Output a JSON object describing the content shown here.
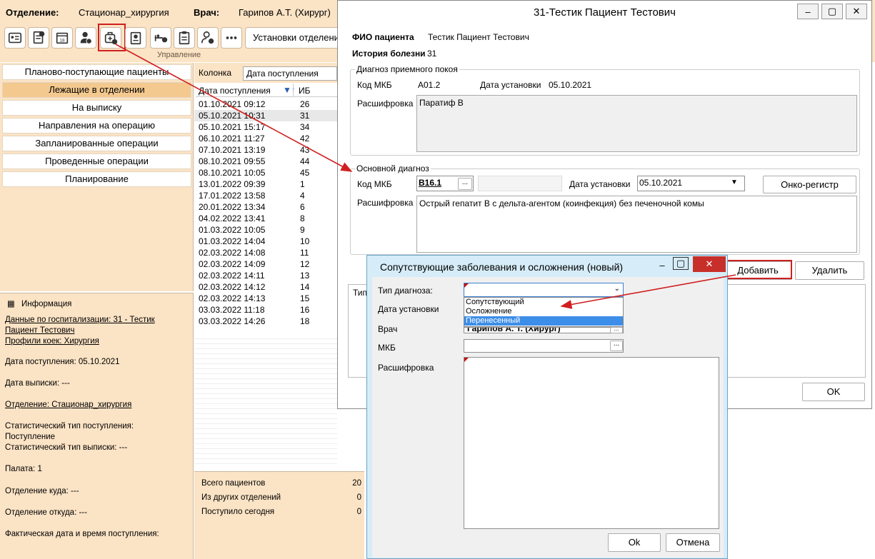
{
  "header": {
    "dept_label": "Отделение:",
    "dept_value": "Стационар_хирургия",
    "doctor_label": "Врач:",
    "doctor_value": "Гарипов А.Т. (Хирург)"
  },
  "toolbar": {
    "group_label": "Управление",
    "settings_label": "Установки отделения",
    "icons": [
      "patient-card-icon",
      "document-add-icon",
      "calendar-icon",
      "doctor-icon",
      "medical-bag-icon",
      "badge-icon",
      "stretcher-icon",
      "clipboard-icon",
      "user-arrow-icon",
      "more-icon"
    ]
  },
  "nav": {
    "items": [
      "Планово-поступающие пациенты",
      "Лежащие в отделении",
      "На выписку",
      "Направления на операцию",
      "Запланированные операции",
      "Проведенные операции",
      "Планирование"
    ],
    "selected": 1
  },
  "list": {
    "column_label": "Колонка",
    "column_value": "Дата поступления",
    "headers": [
      "Дата поступления",
      "ИБ"
    ],
    "rows": [
      [
        "01.10.2021 09:12",
        "26"
      ],
      [
        "05.10.2021 10:31",
        "31"
      ],
      [
        "05.10.2021 15:17",
        "34"
      ],
      [
        "06.10.2021 11:27",
        "42"
      ],
      [
        "07.10.2021 13:19",
        "43"
      ],
      [
        "08.10.2021 09:55",
        "44"
      ],
      [
        "08.10.2021 10:05",
        "45"
      ],
      [
        "13.01.2022 09:39",
        "1"
      ],
      [
        "17.01.2022 13:58",
        "4"
      ],
      [
        "20.01.2022 13:34",
        "6"
      ],
      [
        "04.02.2022 13:41",
        "8"
      ],
      [
        "01.03.2022 10:05",
        "9"
      ],
      [
        "01.03.2022 14:04",
        "10"
      ],
      [
        "02.03.2022 14:08",
        "11"
      ],
      [
        "02.03.2022 14:09",
        "12"
      ],
      [
        "02.03.2022 14:11",
        "13"
      ],
      [
        "02.03.2022 14:12",
        "14"
      ],
      [
        "02.03.2022 14:13",
        "15"
      ],
      [
        "03.03.2022 11:18",
        "16"
      ],
      [
        "03.03.2022 14:26",
        "18"
      ]
    ]
  },
  "info": {
    "title": "Информация",
    "hosp1": "Данные по госпитализации: 31 - Тестик ",
    "hosp2": "Пациент Тестович",
    "beds": "Профили коек: Хирургия",
    "admit": "Дата поступления: 05.10.2021",
    "discharge": "Дата выписки: ---",
    "dept": "Отделение: Стационар_хирургия",
    "stat_in1": "Статистический тип поступления:",
    "stat_in2": "Поступление",
    "stat_out": "Статистический тип выписки: ---",
    "ward": "Палата: 1",
    "dept_to": "Отделение куда: ---",
    "dept_from": "Отделение откуда: ---",
    "actual": "Фактическая дата и время поступления:"
  },
  "stats": {
    "total_label": "Всего пациентов",
    "total": "20",
    "other_label": "Из других отделений",
    "other": "0",
    "today_label": "Поступило сегодня",
    "today": "0"
  },
  "patient": {
    "title": "31-Тестик Пациент Тестович",
    "fio_label": "ФИО пациента",
    "fio": "Тестик Пациент Тестович",
    "history_label": "История болезни",
    "history": "31",
    "adm_group": "Диагноз приемного покоя",
    "mkb_label": "Код МКБ",
    "adm_mkb": "A01.2",
    "date_label": "Дата установки",
    "adm_date": "05.10.2021",
    "decode_label": "Расшифровка",
    "adm_decode": "Паратиф В",
    "main_group": "Основной диагноз",
    "main_mkb": "B16.1",
    "main_date": "05.10.2021",
    "onko": "Онко-регистр",
    "main_decode": "Острый гепатит В с дельта-агентом (коинфекция) без печеночной комы",
    "add": "Добавить",
    "delete": "Удалить",
    "type_col": "Тип",
    "ok": "OK",
    "browse": "..."
  },
  "dialog": {
    "title": "Сопутствующие заболевания и осложнения (новый)",
    "type_label": "Тип диагноза:",
    "date_label": "Дата установки",
    "doctor_label": "Врач",
    "doctor_value": "Гарипов А. Т. (Хирург)",
    "mkb_label": "МКБ",
    "decode_label": "Расшифровка",
    "options": [
      "Сопутствующий",
      "Осложнение",
      "Перенесенный"
    ],
    "highlighted": 2,
    "ok": "Ok",
    "cancel": "Отмена"
  },
  "colors": {
    "accent": "#fbe3c5",
    "selected": "#f4c98f",
    "highlight_red": "#d01f1f",
    "dropdown_sel": "#3c8ee8"
  }
}
